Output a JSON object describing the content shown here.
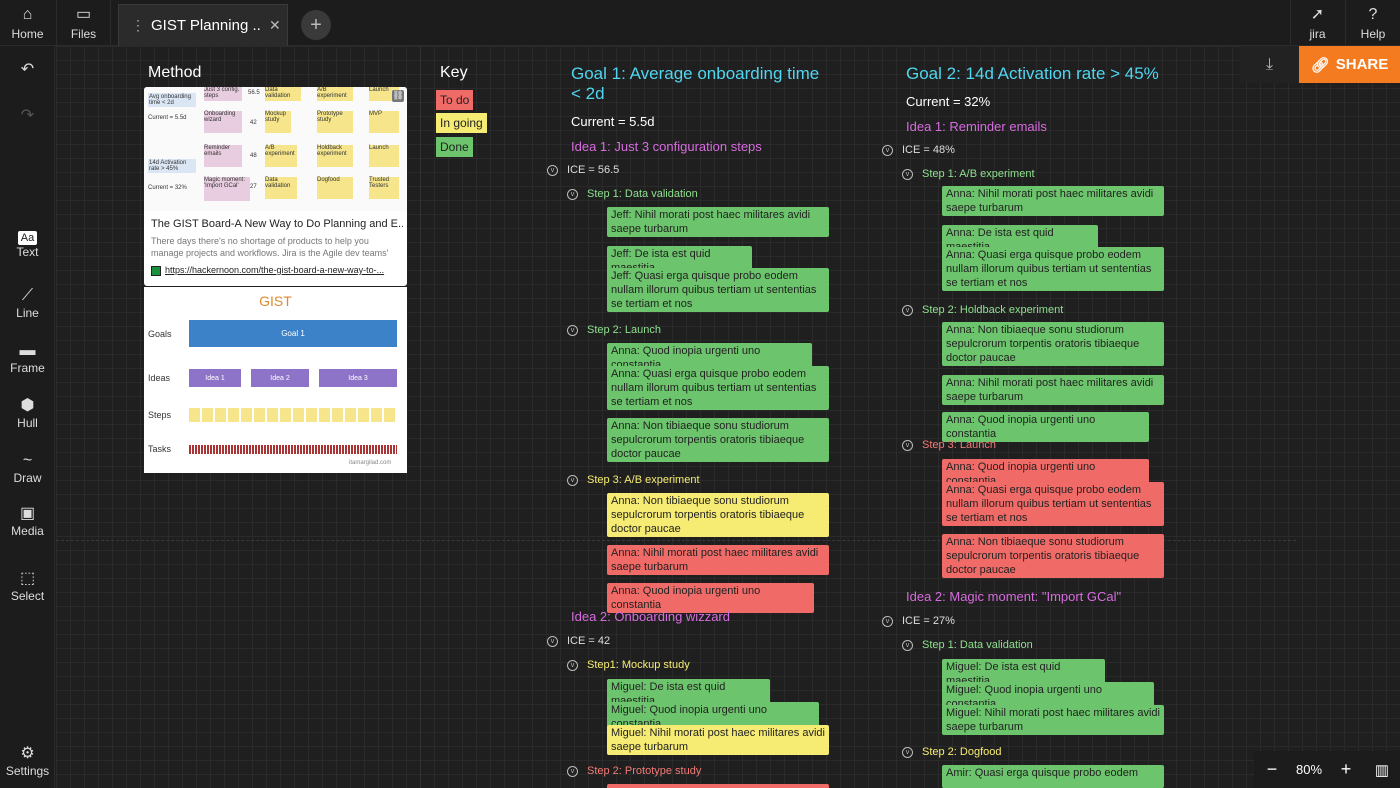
{
  "topbar": {
    "home_label": "Home",
    "files_label": "Files",
    "tab_title": "GIST Planning ...",
    "jira_label": "jira",
    "help_label": "Help",
    "help_glyph": "?"
  },
  "sidebar": {
    "text_label": "Text",
    "text_glyph": "Aa",
    "line_label": "Line",
    "frame_label": "Frame",
    "hull_label": "Hull",
    "draw_label": "Draw",
    "media_label": "Media",
    "select_label": "Select",
    "settings_label": "Settings"
  },
  "actions": {
    "share_label": "SHARE"
  },
  "zoom": {
    "minus": "−",
    "level": "80%",
    "plus": "+"
  },
  "method": {
    "title": "Method",
    "link_title": "The GIST Board-A New Way to Do Planning and E...",
    "link_desc": "There days there's no shortage of products to help you manage projects and workflows. Jira is the Agile dev teams'",
    "link_url": "https://hackernoon.com/the-gist-board-a-new-way-to-...",
    "thumb": {
      "row1_label": "Avg onboarding time < 2d",
      "row1_current": "Current = 5.5d",
      "row2_label": "14d Activation rate > 45%",
      "row2_current": "Current = 32%",
      "n1": "56.5",
      "n2": "42",
      "n3": "48",
      "n4": "27",
      "c1": "Just 3 config. steps",
      "c2": "Data validation",
      "c3": "A/B experiment",
      "c4": "Launch",
      "c5": "Onboarding wizard",
      "c6": "Mockup study",
      "c7": "Prototype study",
      "c8": "MVP",
      "c9": "Reminder emails",
      "c10": "A/B experiment",
      "c11": "Holdback experiment",
      "c12": "Launch",
      "c13": "Magic moment: 'Import GCal'",
      "c14": "Data validation",
      "c15": "Dogfood",
      "c16": "Trusted Testers"
    },
    "gist": {
      "title": "GIST",
      "goals_label": "Goals",
      "ideas_label": "Ideas",
      "steps_label": "Steps",
      "tasks_label": "Tasks",
      "goal_box": "Goal 1",
      "idea1": "Idea 1",
      "idea2": "Idea 2",
      "idea3": "Idea 3",
      "credit": "itamargilad.com"
    }
  },
  "key": {
    "title": "Key",
    "todo": "To do",
    "ingoing": "In going",
    "done": "Done"
  },
  "goal1": {
    "title": "Goal 1: Average onboarding time < 2d",
    "current": "Current = 5.5d",
    "idea1": {
      "title": "Idea 1: Just 3 configuration steps",
      "ice": "ICE = 56.5",
      "step1": "Step 1: Data validation",
      "s1c1": "Jeff: Nihil morati post haec militares avidi saepe turbarum",
      "s1c2": "Jeff: De ista est quid maestitia",
      "s1c3": "Jeff: Quasi erga quisque probo eodem nullam illorum quibus tertiam ut sententias se tertiam et nos",
      "step2": "Step 2: Launch",
      "s2c1": "Anna: Quod inopia urgenti uno constantia",
      "s2c2": "Anna: Quasi erga quisque probo eodem nullam illorum quibus tertiam ut sententias se tertiam et nos",
      "s2c3": "Anna: Non tibiaeque sonu studiorum sepulcrorum torpentis oratoris tibiaeque doctor paucae",
      "step3": "Step 3: A/B experiment",
      "s3c1": "Anna: Non tibiaeque sonu studiorum sepulcrorum torpentis oratoris tibiaeque doctor paucae",
      "s3c2": "Anna: Nihil morati post haec militares avidi saepe turbarum",
      "s3c3": "Anna: Quod inopia urgenti uno constantia"
    },
    "idea2": {
      "title": "Idea 2: Onboarding wizzard",
      "ice": "ICE = 42",
      "step1": "Step1: Mockup study",
      "s1c1": "Miguel: De ista est quid maestitia",
      "s1c2": "Miguel: Quod inopia urgenti uno constantia",
      "s1c3": "Miguel: Nihil morati post haec militares avidi saepe turbarum",
      "step2": "Step 2: Prototype study"
    }
  },
  "goal2": {
    "title": "Goal 2: 14d Activation rate > 45%",
    "current": "Current = 32%",
    "idea1": {
      "title": "Idea 1: Reminder emails",
      "ice": "ICE = 48%",
      "step1": "Step 1: A/B experiment",
      "s1c1": "Anna: Nihil morati post haec militares avidi saepe turbarum",
      "s1c2": "Anna: De ista est quid maestitia",
      "s1c3": "Anna: Quasi erga quisque probo eodem nullam illorum quibus tertiam ut sententias se tertiam et nos",
      "step2": "Step 2: Holdback experiment",
      "s2c1": "Anna: Non tibiaeque sonu studiorum sepulcrorum torpentis oratoris tibiaeque doctor paucae",
      "s2c2": "Anna: Nihil morati post haec militares avidi saepe turbarum",
      "s2c3": "Anna: Quod inopia urgenti uno constantia",
      "step3": "Step 3: Launch",
      "s3c1": "Anna: Quod inopia urgenti uno constantia",
      "s3c2": "Anna: Quasi erga quisque probo eodem nullam illorum quibus tertiam ut sententias se tertiam et nos",
      "s3c3": "Anna: Non tibiaeque sonu studiorum sepulcrorum torpentis oratoris tibiaeque doctor paucae"
    },
    "idea2": {
      "title": "Idea 2: Magic moment: \"Import GCal\"",
      "ice": "ICE = 27%",
      "step1": "Step 1: Data validation",
      "s1c1": "Miguel: De ista est quid maestitia",
      "s1c2": "Miguel: Quod inopia urgenti uno constantia",
      "s1c3": "Miguel: Nihil morati post haec militares avidi saepe turbarum",
      "step2": "Step 2: Dogfood",
      "s2c1": "Amir: Quasi erga quisque probo eodem"
    }
  },
  "colors": {
    "todo": "#f06b67",
    "ingoing": "#f7ec73",
    "done": "#6cc56c",
    "goal": "#4fd6f0",
    "idea": "#d86be0",
    "share": "#f47b20"
  }
}
